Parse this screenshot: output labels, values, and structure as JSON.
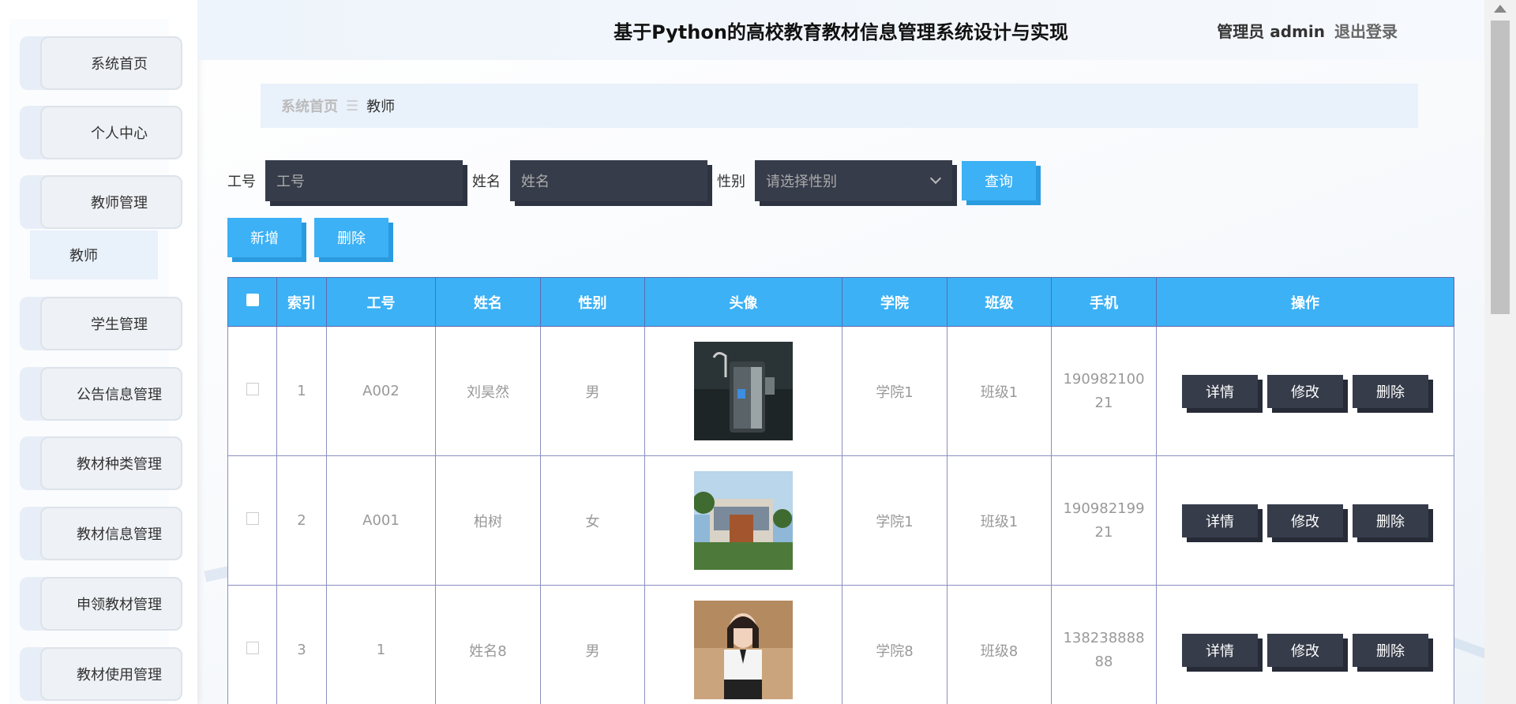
{
  "header": {
    "title": "基于Python的高校教育教材信息管理系统设计与实现",
    "role_user": "管理员 admin",
    "logout": "退出登录"
  },
  "sidebar": {
    "items": [
      {
        "label": "系统首页"
      },
      {
        "label": "个人中心"
      },
      {
        "label": "教师管理"
      },
      {
        "label": "学生管理"
      },
      {
        "label": "公告信息管理"
      },
      {
        "label": "教材种类管理"
      },
      {
        "label": "教材信息管理"
      },
      {
        "label": "申领教材管理"
      },
      {
        "label": "教材使用管理"
      }
    ],
    "submenu": {
      "label": "教师"
    }
  },
  "breadcrumb": {
    "home": "系统首页",
    "sep": "☰",
    "current": "教师"
  },
  "search": {
    "gonghao_label": "工号",
    "gonghao_placeholder": "工号",
    "name_label": "姓名",
    "name_placeholder": "姓名",
    "gender_label": "性别",
    "gender_placeholder": "请选择性别",
    "query": "查询"
  },
  "actions": {
    "add": "新增",
    "delete": "删除"
  },
  "table": {
    "headers": [
      "索引",
      "工号",
      "姓名",
      "性别",
      "头像",
      "学院",
      "班级",
      "手机",
      "操作"
    ],
    "rows": [
      {
        "index": "1",
        "id": "A002",
        "name": "刘昊然",
        "gender": "男",
        "college": "学院1",
        "class": "班级1",
        "phone": "19098210021"
      },
      {
        "index": "2",
        "id": "A001",
        "name": "柏树",
        "gender": "女",
        "college": "学院1",
        "class": "班级1",
        "phone": "19098219921"
      },
      {
        "index": "3",
        "id": "1",
        "name": "姓名8",
        "gender": "男",
        "college": "学院8",
        "class": "班级8",
        "phone": "13823888888"
      }
    ],
    "ops": {
      "detail": "详情",
      "edit": "修改",
      "delete": "删除"
    }
  }
}
